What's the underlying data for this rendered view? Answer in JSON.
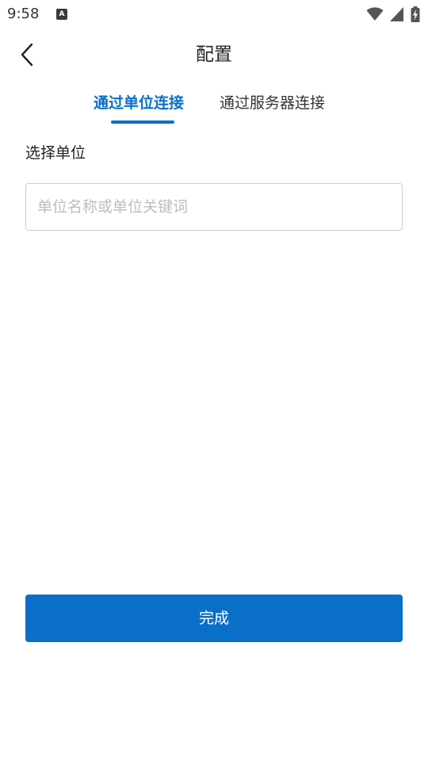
{
  "status_bar": {
    "time": "9:58",
    "notification_icon_letter": "A",
    "icons": [
      "wifi-icon",
      "cell-signal-icon",
      "battery-charging-icon"
    ]
  },
  "header": {
    "title": "配置",
    "back_icon": "chevron-left-icon"
  },
  "tabs": [
    {
      "label": "通过单位连接",
      "active": true
    },
    {
      "label": "通过服务器连接",
      "active": false
    }
  ],
  "form": {
    "section_label": "选择单位",
    "search": {
      "value": "",
      "placeholder": "单位名称或单位关键词"
    }
  },
  "actions": {
    "done_label": "完成"
  },
  "colors": {
    "accent": "#0a6fc9",
    "text": "#222222",
    "placeholder": "#bdbdbd",
    "border": "#cfcfcf"
  }
}
